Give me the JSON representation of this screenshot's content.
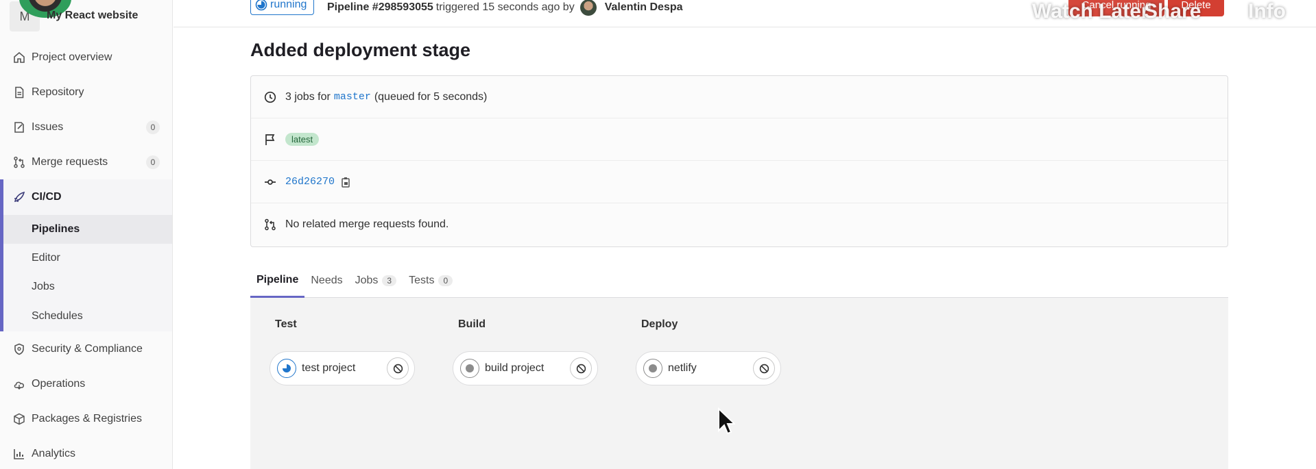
{
  "project": {
    "avatar_letter": "M",
    "name": "My React website"
  },
  "sidebar": {
    "items": [
      {
        "label": "Project overview",
        "icon": "home-icon"
      },
      {
        "label": "Repository",
        "icon": "document-icon"
      },
      {
        "label": "Issues",
        "icon": "issues-icon",
        "count": "0"
      },
      {
        "label": "Merge requests",
        "icon": "merge-request-icon",
        "count": "0"
      },
      {
        "label": "CI/CD",
        "icon": "rocket-icon",
        "active": true
      },
      {
        "label": "Security & Compliance",
        "icon": "shield-icon"
      },
      {
        "label": "Operations",
        "icon": "cloud-icon"
      },
      {
        "label": "Packages & Registries",
        "icon": "package-icon"
      },
      {
        "label": "Analytics",
        "icon": "chart-icon"
      }
    ],
    "cicd_sub": [
      "Pipelines",
      "Editor",
      "Jobs",
      "Schedules"
    ],
    "active_sub": "Pipelines"
  },
  "header": {
    "status": "running",
    "pipeline_id": "Pipeline #298593055",
    "triggered_text": "triggered 15 seconds ago by",
    "user": "Valentin Despa",
    "cancel_label": "Cancel running",
    "delete_label": "Delete"
  },
  "overlay": {
    "watch_later": "Watch Later",
    "share": "Share",
    "info": "Info"
  },
  "title": "Added deployment stage",
  "info": {
    "jobs_prefix": "3 jobs for",
    "branch": "master",
    "jobs_suffix": "(queued for 5 seconds)",
    "badge": "latest",
    "commit_sha": "26d26270",
    "mr_text": "No related merge requests found."
  },
  "tabs": [
    {
      "label": "Pipeline",
      "active": true
    },
    {
      "label": "Needs"
    },
    {
      "label": "Jobs",
      "count": "3"
    },
    {
      "label": "Tests",
      "count": "0"
    }
  ],
  "stages": [
    {
      "name": "Test",
      "job": "test project",
      "status": "running"
    },
    {
      "name": "Build",
      "job": "build project",
      "status": "created"
    },
    {
      "name": "Deploy",
      "job": "netlify",
      "status": "created"
    }
  ],
  "colors": {
    "accent": "#6666c4",
    "link": "#1f75cb",
    "danger": "#d33f32",
    "badge_bg": "#c3e6cd"
  }
}
